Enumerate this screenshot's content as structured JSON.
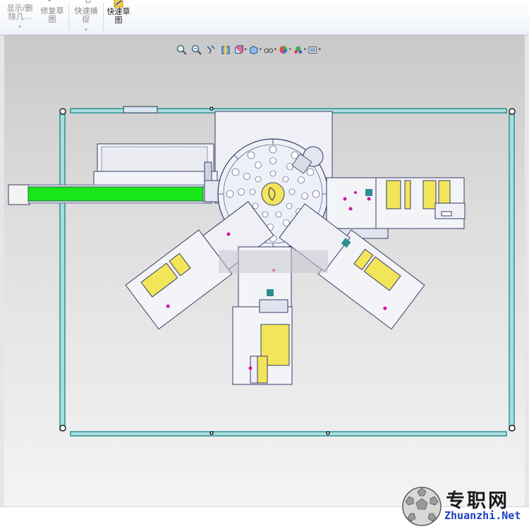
{
  "ribbon": {
    "buttons": [
      {
        "label": "显示/删\n除几...",
        "icon": "show-hide-geometry-icon",
        "active": false
      },
      {
        "label": "修复草\n图",
        "icon": "repair-sketch-icon",
        "active": false
      },
      {
        "label": "快速捕\n捉",
        "icon": "quick-snap-icon",
        "active": false
      },
      {
        "label": "快速草\n图",
        "icon": "rapid-sketch-icon",
        "active": true
      }
    ]
  },
  "hud_toolbar": [
    {
      "icon": "zoom-to-fit-icon"
    },
    {
      "icon": "zoom-to-area-icon"
    },
    {
      "icon": "previous-view-icon"
    },
    {
      "icon": "section-view-icon"
    },
    {
      "icon": "view-orientation-icon"
    },
    {
      "icon": "display-style-icon"
    },
    {
      "icon": "hide-show-items-icon"
    },
    {
      "icon": "edit-appearance-icon"
    },
    {
      "icon": "apply-scene-icon"
    },
    {
      "icon": "view-settings-icon"
    }
  ],
  "colors": {
    "frame_teal": "#2f8f8f",
    "infeed_green": "#19e619",
    "drawing_line": "#3a3a66",
    "accent_yellow": "#f2e55a",
    "accent_magenta": "#d4159a"
  },
  "watermark": {
    "brand_cn": "专职网",
    "brand_en": "Zhuanzhi.Net"
  }
}
